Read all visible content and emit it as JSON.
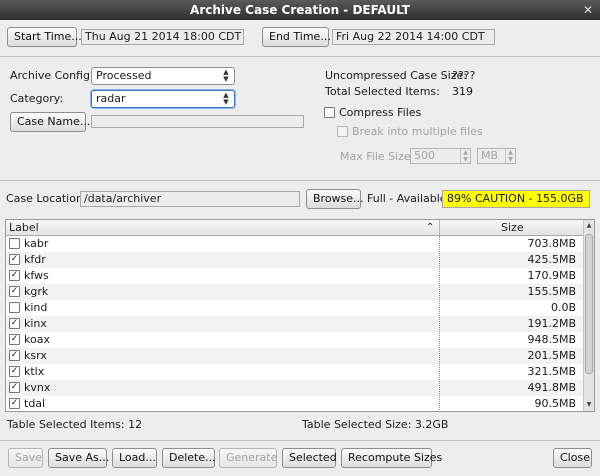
{
  "window": {
    "title": "Archive Case Creation - DEFAULT",
    "close_glyph": "✕"
  },
  "time": {
    "start_label": "Start Time...",
    "start_value": "Thu Aug 21 2014 18:00 CDT",
    "end_label": "End Time...",
    "end_value": "Fri Aug 22 2014 14:00 CDT"
  },
  "config": {
    "archive_config_label": "Archive Config:",
    "archive_config_value": "Processed",
    "category_label": "Category:",
    "category_value": "radar",
    "case_name_button": "Case Name...",
    "case_name_value": ""
  },
  "summary": {
    "uncompressed_label": "Uncompressed Case Size:",
    "uncompressed_value": "????",
    "total_selected_label": "Total Selected Items:",
    "total_selected_value": "319",
    "compress_label": "Compress Files",
    "break_label": "Break into multiple files",
    "max_file_size_label": "Max File Size:",
    "max_file_size_value": "500",
    "max_file_size_unit": "MB"
  },
  "location": {
    "label": "Case Location:",
    "value": "/data/archiver",
    "browse_button": "Browse...",
    "full_label": "Full - Available:",
    "full_value": "89% CAUTION - 155.0GB",
    "caution_color": "#ffff00"
  },
  "table": {
    "col_label": "Label",
    "col_size": "Size",
    "sort_glyph": "⌃",
    "rows": [
      {
        "label": "kabr",
        "size": "703.8MB",
        "checked": false
      },
      {
        "label": "kfdr",
        "size": "425.5MB",
        "checked": true
      },
      {
        "label": "kfws",
        "size": "170.9MB",
        "checked": true
      },
      {
        "label": "kgrk",
        "size": "155.5MB",
        "checked": true
      },
      {
        "label": "kind",
        "size": "0.0B",
        "checked": false
      },
      {
        "label": "kinx",
        "size": "191.2MB",
        "checked": true
      },
      {
        "label": "koax",
        "size": "948.5MB",
        "checked": true
      },
      {
        "label": "ksrx",
        "size": "201.5MB",
        "checked": true
      },
      {
        "label": "ktlx",
        "size": "321.5MB",
        "checked": true
      },
      {
        "label": "kvnx",
        "size": "491.8MB",
        "checked": true
      },
      {
        "label": "tdal",
        "size": "90.5MB",
        "checked": true
      }
    ]
  },
  "footer": {
    "selected_items_text": "Table Selected Items: 12",
    "selected_size_text": "Table Selected Size: 3.2GB"
  },
  "buttons": {
    "save": "Save",
    "save_as": "Save As...",
    "load": "Load...",
    "delete": "Delete...",
    "generate": "Generate",
    "selected": "Selected",
    "recompute": "Recompute Sizes",
    "close": "Close"
  }
}
